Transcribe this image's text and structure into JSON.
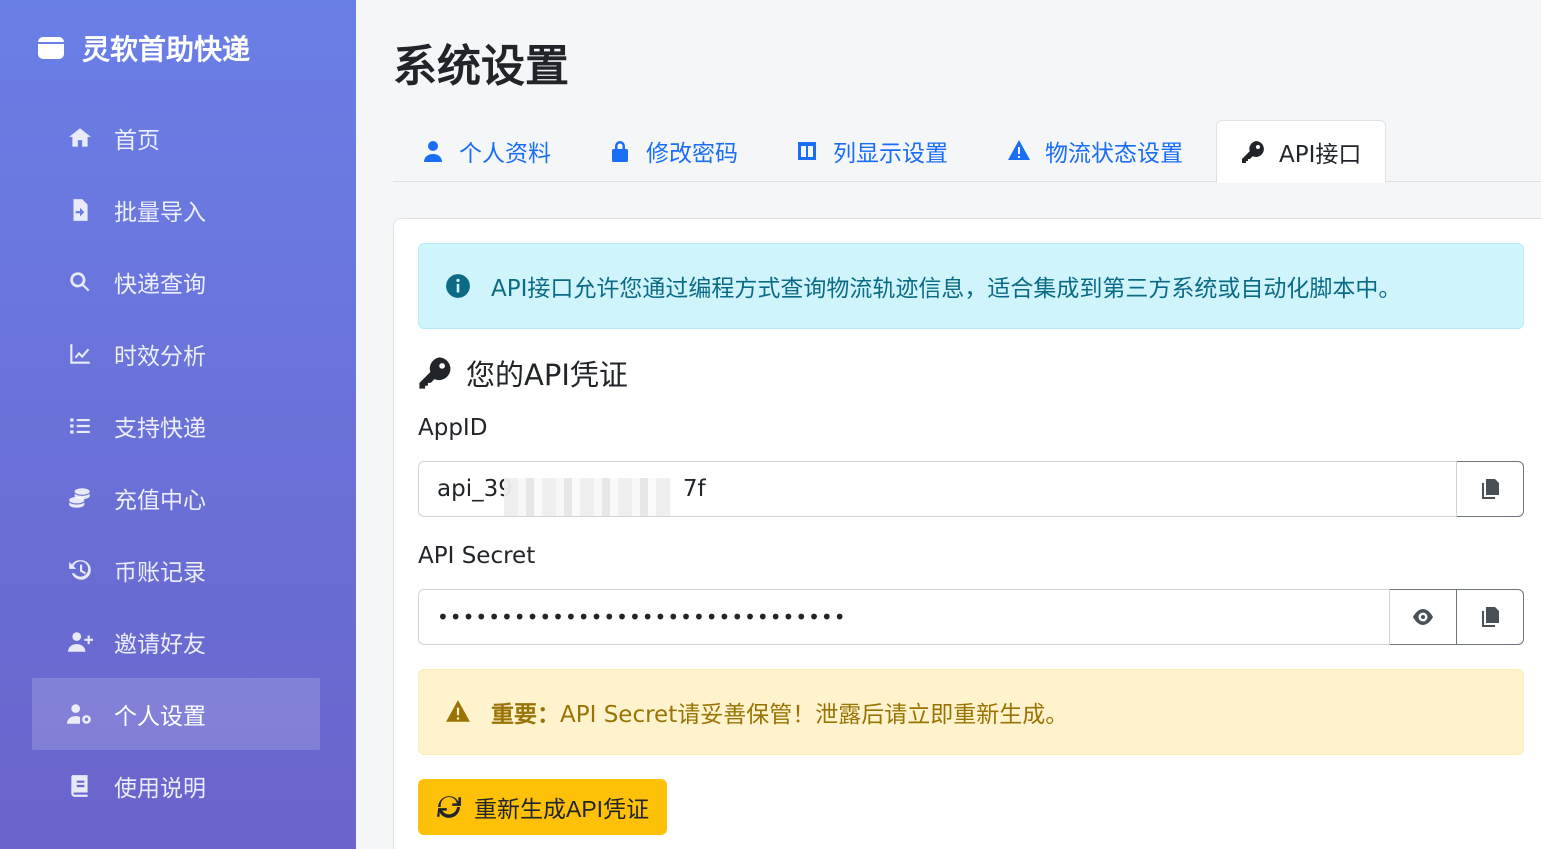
{
  "brand": {
    "name": "灵软首助快递",
    "icon": "box-icon"
  },
  "sidebar": {
    "items": [
      {
        "label": "首页",
        "icon": "home-icon",
        "active": false
      },
      {
        "label": "批量导入",
        "icon": "file-import-icon",
        "active": false
      },
      {
        "label": "快递查询",
        "icon": "search-icon",
        "active": false
      },
      {
        "label": "时效分析",
        "icon": "chart-line-icon",
        "active": false
      },
      {
        "label": "支持快递",
        "icon": "list-icon",
        "active": false
      },
      {
        "label": "充值中心",
        "icon": "coins-icon",
        "active": false
      },
      {
        "label": "币账记录",
        "icon": "history-icon",
        "active": false
      },
      {
        "label": "邀请好友",
        "icon": "user-plus-icon",
        "active": false
      },
      {
        "label": "个人设置",
        "icon": "user-gear-icon",
        "active": true
      },
      {
        "label": "使用说明",
        "icon": "book-icon",
        "active": false
      }
    ]
  },
  "page": {
    "title": "系统设置"
  },
  "tabs": [
    {
      "label": "个人资料",
      "icon": "user-icon"
    },
    {
      "label": "修改密码",
      "icon": "lock-icon"
    },
    {
      "label": "列显示设置",
      "icon": "columns-icon"
    },
    {
      "label": "物流状态设置",
      "icon": "warning-icon"
    },
    {
      "label": "API接口",
      "icon": "key-icon",
      "active": true
    }
  ],
  "api": {
    "info_text": "API接口允许您通过编程方式查询物流轨迹信息，适合集成到第三方系统或自动化脚本中。",
    "section_title": "您的API凭证",
    "appid_label": "AppID",
    "appid_prefix": "api_39",
    "appid_suffix": "7f",
    "secret_label": "API Secret",
    "secret_masked": "••••••••••••••••••••••••••••••••",
    "warning_strong": "重要：",
    "warning_text": "API Secret请妥善保管！泄露后请立即重新生成。",
    "regenerate_label": "重新生成API凭证"
  },
  "colors": {
    "sidebar_gradient_top": "#6a7fe6",
    "accent": "#1a6ef5",
    "info_bg": "#cff4fc",
    "warning_bg": "#fff3cd",
    "regen_btn": "#ffc107"
  }
}
